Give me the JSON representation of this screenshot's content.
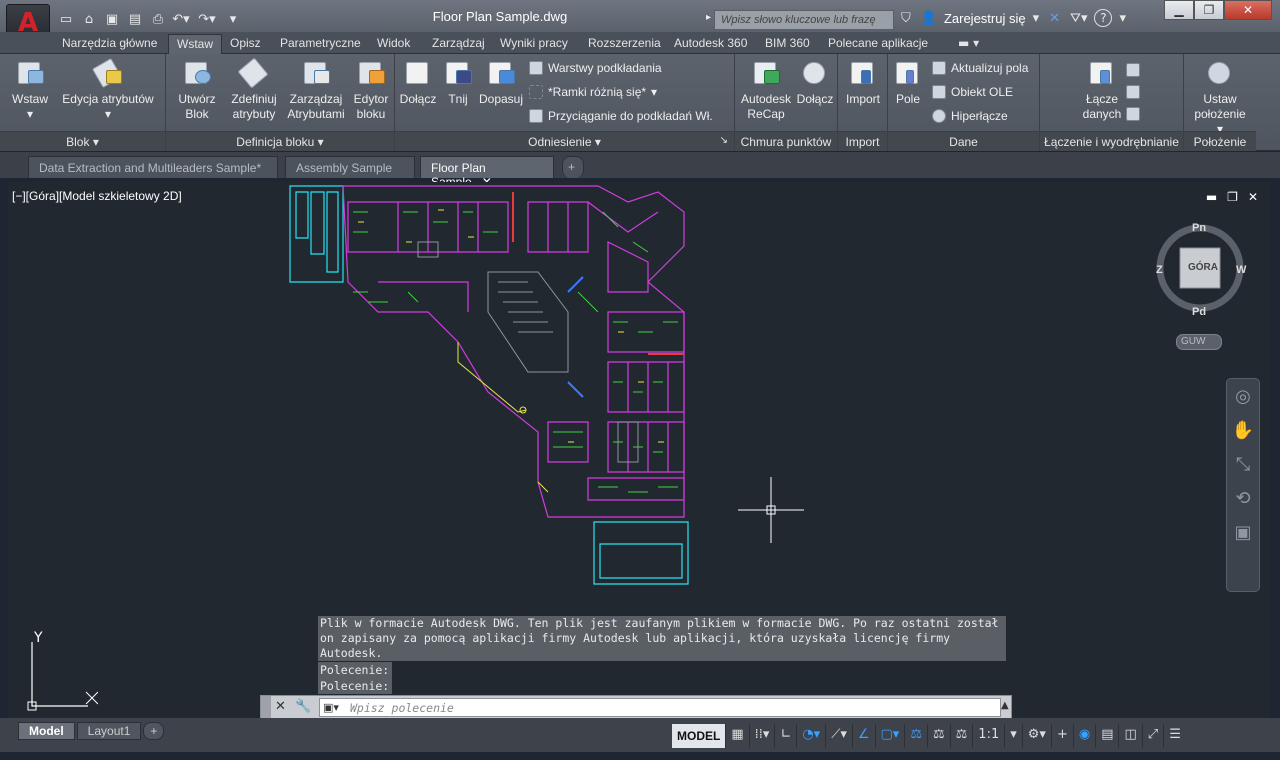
{
  "app": {
    "logo_letter": "A",
    "window_title": "Floor Plan Sample.dwg"
  },
  "header": {
    "search_placeholder": "Wpisz słowo kluczowe lub frazę",
    "sign_in_label": "Zarejestruj się",
    "help_label": "?"
  },
  "quick_access": [
    "new-icon",
    "open-icon",
    "save-icon",
    "saveas-icon",
    "print-icon",
    "undo-icon",
    "redo-icon",
    "customize-icon"
  ],
  "ribbon_tabs": [
    {
      "label": "Narzędzia główne"
    },
    {
      "label": "Wstaw",
      "active": true
    },
    {
      "label": "Opisz"
    },
    {
      "label": "Parametryczne"
    },
    {
      "label": "Widok"
    },
    {
      "label": "Zarządzaj"
    },
    {
      "label": "Wyniki pracy"
    },
    {
      "label": "Rozszerzenia"
    },
    {
      "label": "Autodesk 360"
    },
    {
      "label": "BIM 360"
    },
    {
      "label": "Polecane aplikacje"
    }
  ],
  "ribbon": {
    "blok": {
      "label": "Blok",
      "wstaw": "Wstaw",
      "edycja": "Edycja atrybutów"
    },
    "definicja": {
      "label": "Definicja bloku",
      "utworz_1": "Utwórz",
      "utworz_2": "Blok",
      "zdefiniuj_1": "Zdefiniuj",
      "zdefiniuj_2": "atrybuty",
      "zarzadzaj_1": "Zarządzaj",
      "zarzadzaj_2": "Atrybutami",
      "edytor_1": "Edytor",
      "edytor_2": "bloku"
    },
    "odniesienie": {
      "label": "Odniesienie",
      "dolacz": "Dołącz",
      "tnij": "Tnij",
      "dopasuj": "Dopasuj",
      "warstwy": "Warstwy podkładania",
      "ramki": "*Ramki różnią się*",
      "przyciaganie": "Przyciąganie do podkładań Wł."
    },
    "chmura": {
      "label": "Chmura punktów",
      "recap_1": "Autodesk",
      "recap_2": "ReCap",
      "dolacz": "Dołącz"
    },
    "import": {
      "label": "Import",
      "import": "Import"
    },
    "dane": {
      "label": "Dane",
      "pole": "Pole",
      "aktualizuj": "Aktualizuj pola",
      "obiekt_ole": "Obiekt OLE",
      "hiperlacze": "Hiperłącze"
    },
    "laczenie": {
      "label": "Łączenie i wyodrębnianie",
      "lacze_1": "Łącze",
      "lacze_2": "danych"
    },
    "polozenie": {
      "label": "Położenie",
      "ustaw_1": "Ustaw",
      "ustaw_2": "położenie"
    }
  },
  "doc_tabs": [
    {
      "label": "Data Extraction and Multileaders Sample*"
    },
    {
      "label": "Assembly Sample"
    },
    {
      "label": "Floor Plan Sample",
      "active": true
    }
  ],
  "viewport": {
    "label": "[−][Góra][Model szkieletowy 2D]",
    "cube": {
      "top": "GÓRA",
      "n": "Pn",
      "s": "Pd",
      "w": "Z",
      "e": "W",
      "ucs": "GUW"
    },
    "ucs_y": "Y",
    "ucs_x": "X"
  },
  "command": {
    "history": "Plik w formacie Autodesk DWG. Ten plik jest zaufanym plikiem w formacie DWG. Po raz ostatni został on zapisany za pomocą aplikacji firmy Autodesk lub aplikacji, która uzyskała licencję firmy Autodesk.",
    "prompt_1": "Polecenie:",
    "prompt_2": "Polecenie:",
    "input_placeholder": "Wpisz polecenie"
  },
  "layout_tabs": [
    {
      "label": "Model",
      "active": true
    },
    {
      "label": "Layout1"
    }
  ],
  "status": {
    "model": "MODEL",
    "scale": "1:1"
  },
  "colors": {
    "accent": "#d2232a",
    "canvas": "#212830",
    "cyan": "#27e3f2",
    "magenta": "#d23ce0",
    "yellow": "#e8e84a",
    "green": "#3fd23f"
  }
}
